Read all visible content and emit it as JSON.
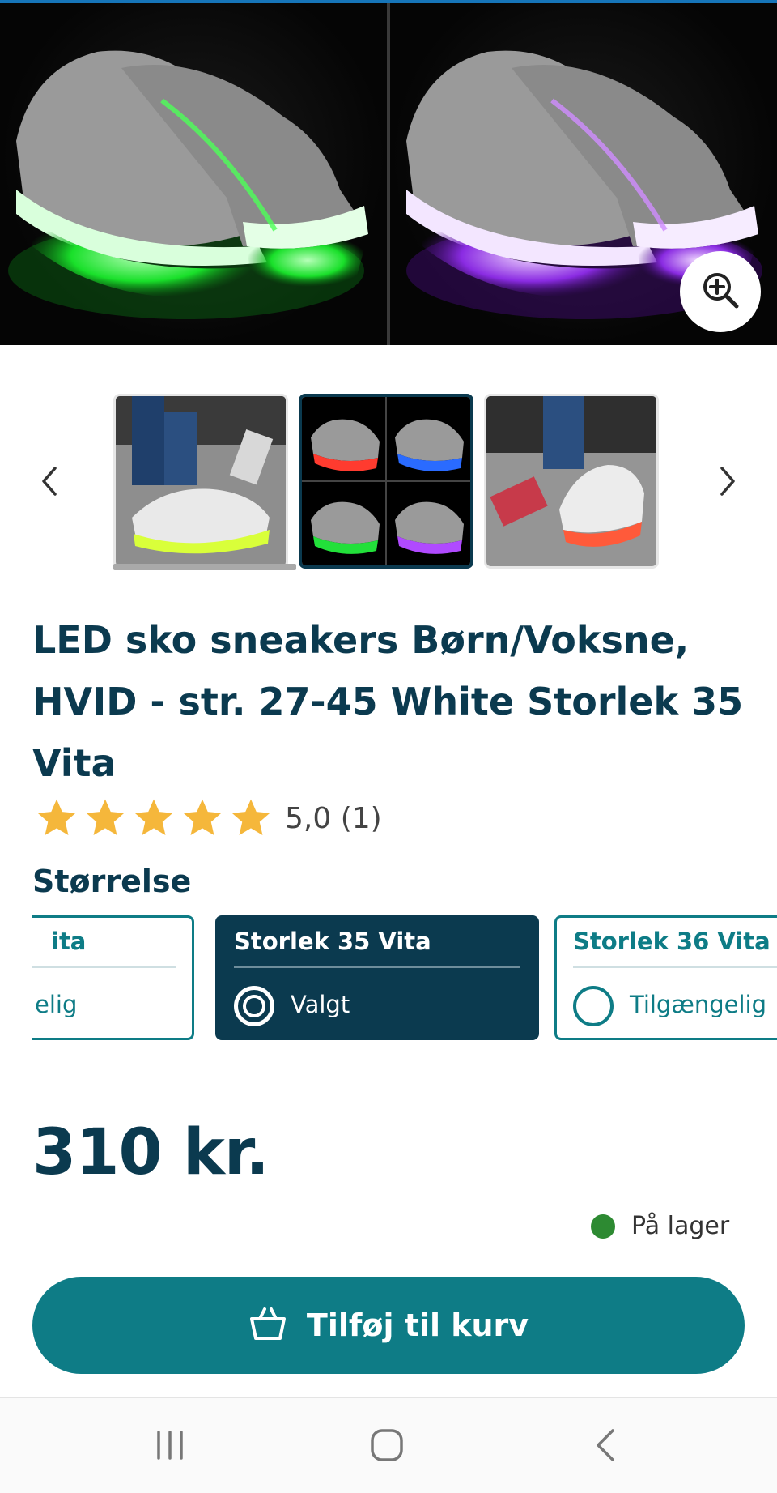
{
  "product": {
    "title": "LED sko sneakers Børn/Voksne, HVID - str. 27-45 White Storlek 35 Vita",
    "rating_value": 5,
    "rating_max": 5,
    "rating_text": "5,0 (1)",
    "price": "310 kr."
  },
  "gallery": {
    "thumbnails": [
      {
        "desc": "worn sneaker yellow-green glow"
      },
      {
        "desc": "four color variants grid",
        "selected": true
      },
      {
        "desc": "worn sneaker red glow"
      }
    ]
  },
  "sizes": {
    "label": "Størrelse",
    "options": [
      {
        "name": "ita",
        "status": "elig"
      },
      {
        "name": "Storlek 35 Vita",
        "status": "Valgt"
      },
      {
        "name": "Storlek 36 Vita",
        "status": "Tilgængelig"
      }
    ]
  },
  "stock": {
    "text": "På lager",
    "color": "#2d8a32"
  },
  "cart_button": {
    "label": "Tilføj til kurv"
  },
  "colors": {
    "primary": "#0b3a4f",
    "accent": "#0e7c86",
    "star": "#f5b73b"
  },
  "icons": {
    "zoom": "zoom-in-icon",
    "prev": "chevron-left-icon",
    "next": "chevron-right-icon",
    "cart": "basket-icon",
    "nav_recents": "recents-icon",
    "nav_home": "home-icon",
    "nav_back": "back-icon"
  }
}
